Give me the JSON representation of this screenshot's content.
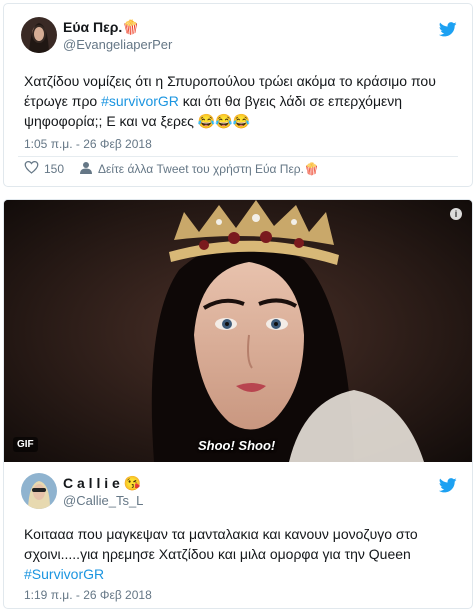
{
  "tweet1": {
    "name": "Εύα Περ.",
    "name_emoji": "🍿",
    "handle": "@EvangeliaperPer",
    "text_before": "Χατζίδου νομίζεις ότι η Σπυροπούλου τρώει ακόμα το κράσιμο που έτρωγε προ ",
    "hashtag": "#survivorGR",
    "text_after": " και ότι θα βγεις λάδι σε επερχόμενη ψηφοφορία;; Ε και να ξερες 😂😂😂",
    "time": "1:05 π.μ. - 26 Φεβ 2018",
    "likes": "150",
    "more_link": "Δείτε άλλα Tweet του χρήστη Εύα Περ.🍿"
  },
  "tweet2": {
    "media_type": "GIF",
    "caption": "Shoo! Shoo!",
    "info_glyph": "i",
    "name": "C a l l i e",
    "name_emoji": "😘",
    "handle": "@Callie_Ts_L",
    "text_before": "Κοιτααα που μαγκεψαν τα μανταλακια και κανουν μονοζυγο στο σχοινι.....για ηρεμησε Χατζίδου και μιλα ομορφα για την Queen ",
    "hashtag": "#SurvivorGR",
    "time": "1:19 π.μ. - 26 Φεβ 2018"
  },
  "colors": {
    "twitter_blue": "#1da1f2",
    "link": "#1b95e0",
    "muted": "#657786"
  },
  "icons": [
    "twitter-bird-icon",
    "heart-icon",
    "info-icon"
  ]
}
